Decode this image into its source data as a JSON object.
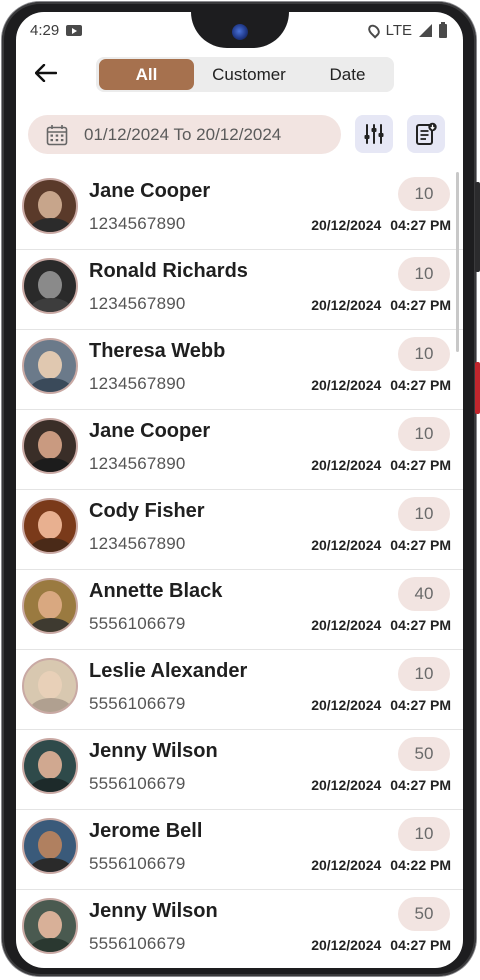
{
  "status_bar": {
    "time": "4:29",
    "network": "LTE"
  },
  "header": {
    "tabs": [
      {
        "label": "All",
        "active": true
      },
      {
        "label": "Customer",
        "active": false
      },
      {
        "label": "Date",
        "active": false
      }
    ]
  },
  "filter": {
    "date_range": "01/12/2024 To 20/12/2024"
  },
  "colors": {
    "accent": "#a6714e",
    "chip_bg": "#f2e4e1",
    "icon_btn_bg": "#e6e7f5"
  },
  "icons": {
    "back": "arrow-left-icon",
    "calendar": "calendar-icon",
    "filter": "sliders-icon",
    "report": "report-download-icon"
  },
  "entries": [
    {
      "name": "Jane Cooper",
      "phone": "1234567890",
      "count": "10",
      "date": "20/12/2024",
      "time": "04:27 PM"
    },
    {
      "name": "Ronald Richards",
      "phone": "1234567890",
      "count": "10",
      "date": "20/12/2024",
      "time": "04:27 PM"
    },
    {
      "name": "Theresa Webb",
      "phone": "1234567890",
      "count": "10",
      "date": "20/12/2024",
      "time": "04:27 PM"
    },
    {
      "name": "Jane Cooper",
      "phone": "1234567890",
      "count": "10",
      "date": "20/12/2024",
      "time": "04:27 PM"
    },
    {
      "name": "Cody Fisher",
      "phone": "1234567890",
      "count": "10",
      "date": "20/12/2024",
      "time": "04:27 PM"
    },
    {
      "name": "Annette Black",
      "phone": "5556106679",
      "count": "40",
      "date": "20/12/2024",
      "time": "04:27 PM"
    },
    {
      "name": "Leslie Alexander",
      "phone": "5556106679",
      "count": "10",
      "date": "20/12/2024",
      "time": "04:27 PM"
    },
    {
      "name": "Jenny Wilson",
      "phone": "5556106679",
      "count": "50",
      "date": "20/12/2024",
      "time": "04:27 PM"
    },
    {
      "name": "Jerome Bell",
      "phone": "5556106679",
      "count": "10",
      "date": "20/12/2024",
      "time": "04:22 PM"
    },
    {
      "name": "Jenny Wilson",
      "phone": "5556106679",
      "count": "50",
      "date": "20/12/2024",
      "time": "04:27 PM"
    }
  ]
}
